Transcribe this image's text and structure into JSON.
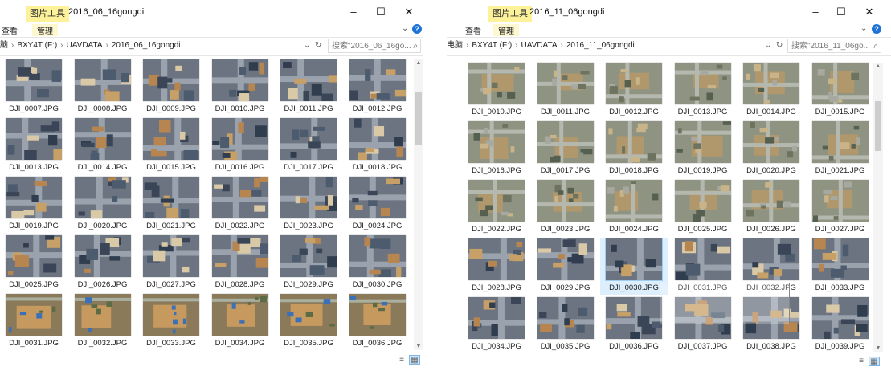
{
  "left": {
    "context_tab": "图片工具",
    "title": "2016_06_16gongdi",
    "ribbon_view": "查看",
    "ribbon_manage": "管理",
    "breadcrumb": [
      "脑",
      "BXY4T (F:)",
      "UAVDATA",
      "2016_06_16gongdi"
    ],
    "search_placeholder": "搜索\"2016_06_16go...",
    "files": [
      "DJI_0007.JPG",
      "DJI_0008.JPG",
      "DJI_0009.JPG",
      "DJI_0010.JPG",
      "DJI_0011.JPG",
      "DJI_0012.JPG",
      "DJI_0013.JPG",
      "DJI_0014.JPG",
      "DJI_0015.JPG",
      "DJI_0016.JPG",
      "DJI_0017.JPG",
      "DJI_0018.JPG",
      "DJI_0019.JPG",
      "DJI_0020.JPG",
      "DJI_0021.JPG",
      "DJI_0022.JPG",
      "DJI_0023.JPG",
      "DJI_0024.JPG",
      "DJI_0025.JPG",
      "DJI_0026.JPG",
      "DJI_0027.JPG",
      "DJI_0028.JPG",
      "DJI_0029.JPG",
      "DJI_0030.JPG",
      "DJI_0031.JPG",
      "DJI_0032.JPG",
      "DJI_0033.JPG",
      "DJI_0034.JPG",
      "DJI_0035.JPG",
      "DJI_0036.JPG"
    ]
  },
  "right": {
    "context_tab": "图片工具",
    "title": "2016_11_06gongdi",
    "ribbon_view": "查看",
    "ribbon_manage": "管理",
    "breadcrumb": [
      "电脑",
      "BXY4T (F:)",
      "UAVDATA",
      "2016_11_06gongdi"
    ],
    "search_placeholder": "搜索\"2016_11_06go...",
    "files": [
      "DJI_0010.JPG",
      "DJI_0011.JPG",
      "DJI_0012.JPG",
      "DJI_0013.JPG",
      "DJI_0014.JPG",
      "DJI_0015.JPG",
      "DJI_0016.JPG",
      "DJI_0017.JPG",
      "DJI_0018.JPG",
      "DJI_0019.JPG",
      "DJI_0020.JPG",
      "DJI_0021.JPG",
      "DJI_0022.JPG",
      "DJI_0023.JPG",
      "DJI_0024.JPG",
      "DJI_0025.JPG",
      "DJI_0026.JPG",
      "DJI_0027.JPG",
      "DJI_0028.JPG",
      "DJI_0029.JPG",
      "DJI_0030.JPG",
      "DJI_0031.JPG",
      "DJI_0032.JPG",
      "DJI_0033.JPG",
      "DJI_0034.JPG",
      "DJI_0035.JPG",
      "DJI_0036.JPG",
      "DJI_0037.JPG",
      "DJI_0038.JPG",
      "DJI_0039.JPG"
    ],
    "selected_file": "DJI_0030.JPG"
  },
  "window_controls": {
    "minimize": "–",
    "maximize": "☐",
    "close": "✕"
  },
  "icons": {
    "help": "help-icon",
    "expand": "chevron-down-icon",
    "refresh": "refresh-icon",
    "search": "search-icon",
    "details_view": "details-view-icon",
    "thumbnail_view": "thumbnail-view-icon"
  },
  "colors": {
    "context_tab_bg": "#fdf29a",
    "help_blue": "#1e73d8",
    "selection": "#ddeefc"
  }
}
